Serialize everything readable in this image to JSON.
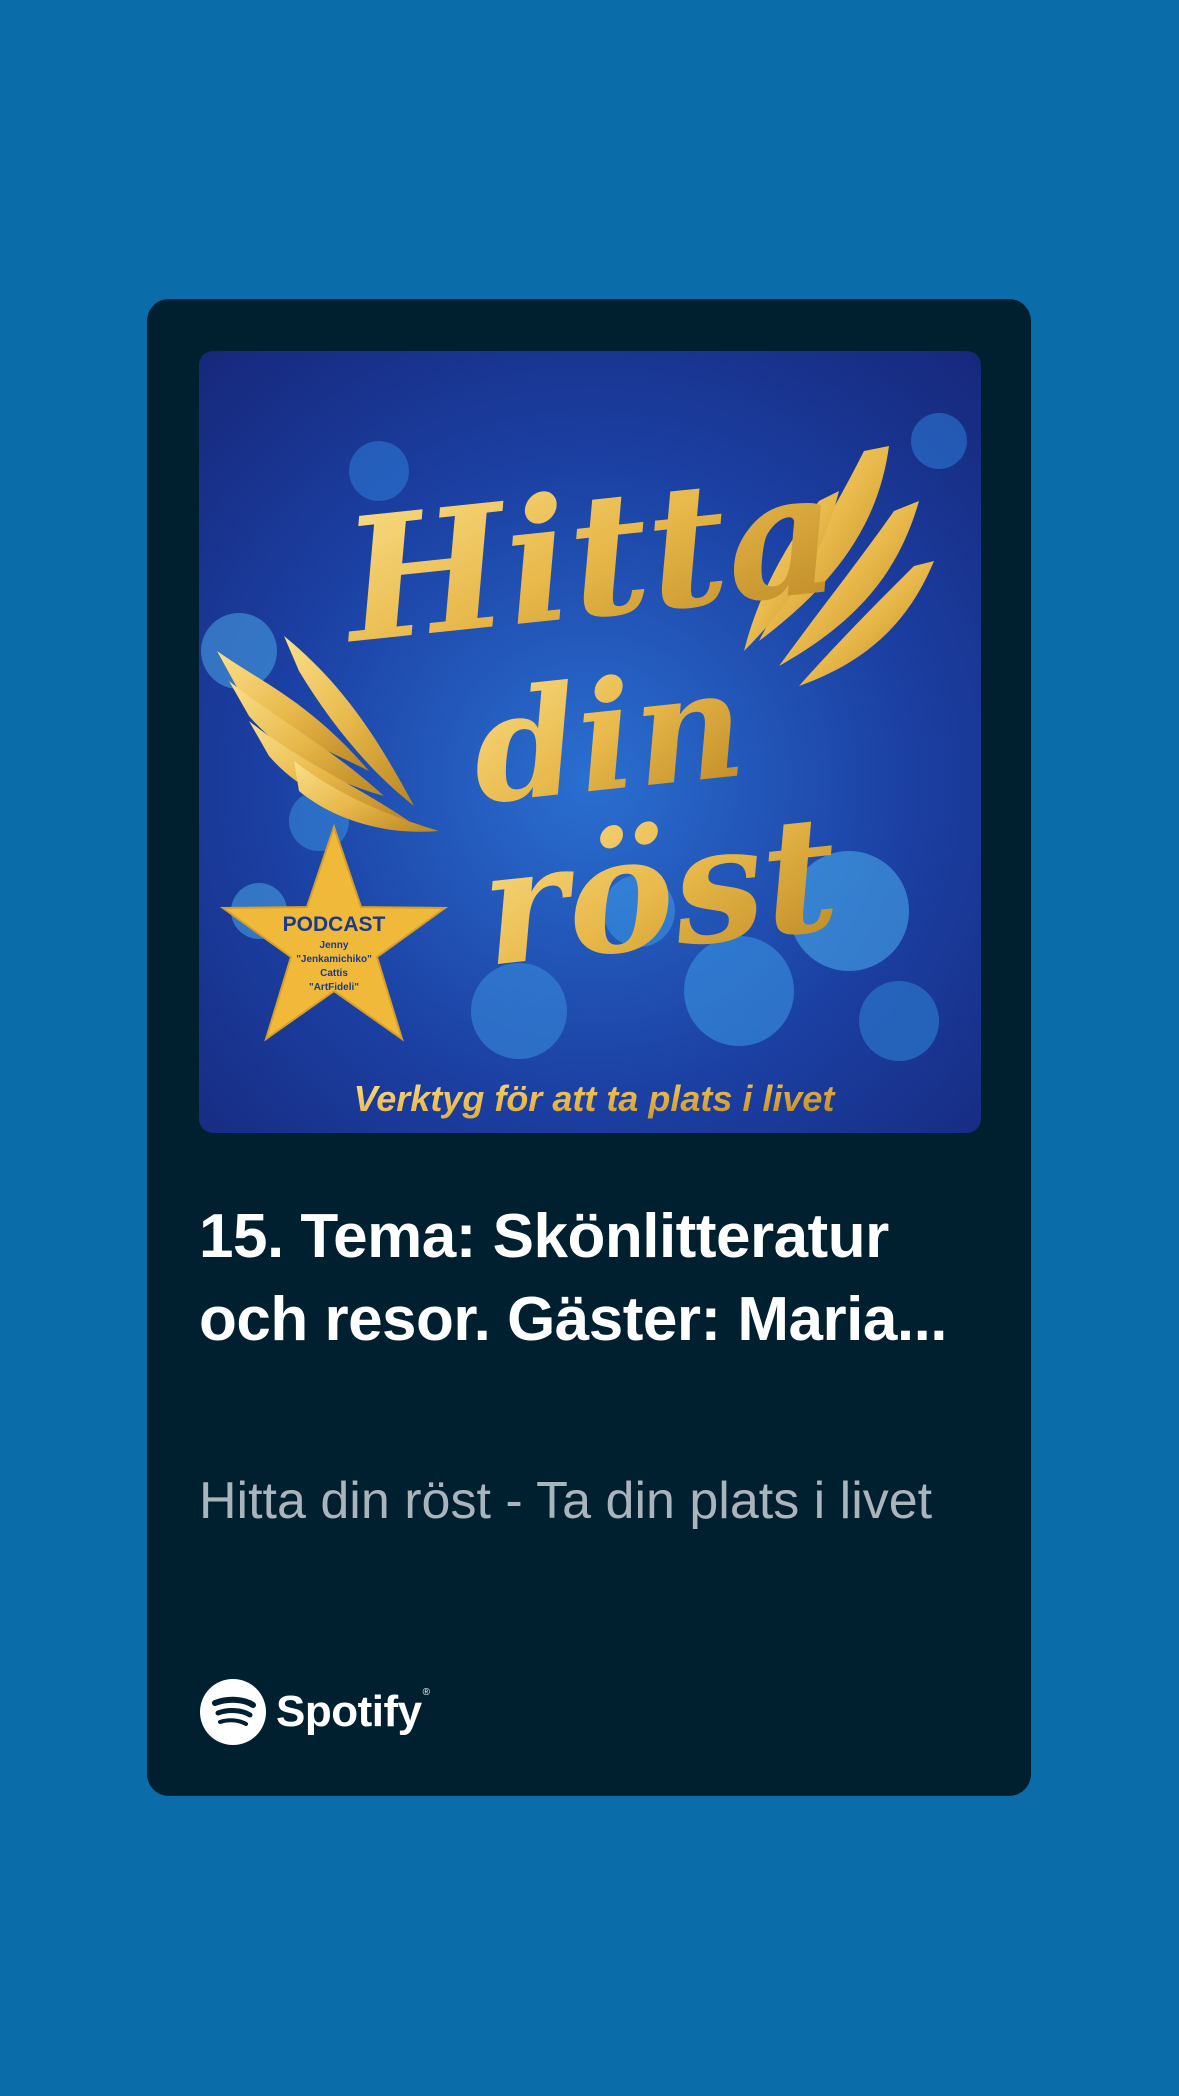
{
  "episode": {
    "title": "15. Tema: Skönlitteratur och resor. Gäster: Maria...",
    "show": "Hitta din röst - Ta din plats i livet"
  },
  "cover": {
    "title_lines": [
      "Hitta",
      "din",
      "röst"
    ],
    "tagline": "Verktyg för att ta plats i livet",
    "star_badge": {
      "heading": "PODCAST",
      "lines": [
        "Jenny",
        "\"Jenkamichiko\"",
        "Cattis",
        "\"ArtFideli\""
      ]
    }
  },
  "brand": {
    "name": "Spotify",
    "icon": "spotify-logo-icon"
  },
  "colors": {
    "background": "#0a6ca8",
    "card": "#01202f",
    "title": "#ffffff",
    "subtitle": "#aab4bc",
    "gold": "#e8b84a",
    "star": "#f0b93a"
  }
}
